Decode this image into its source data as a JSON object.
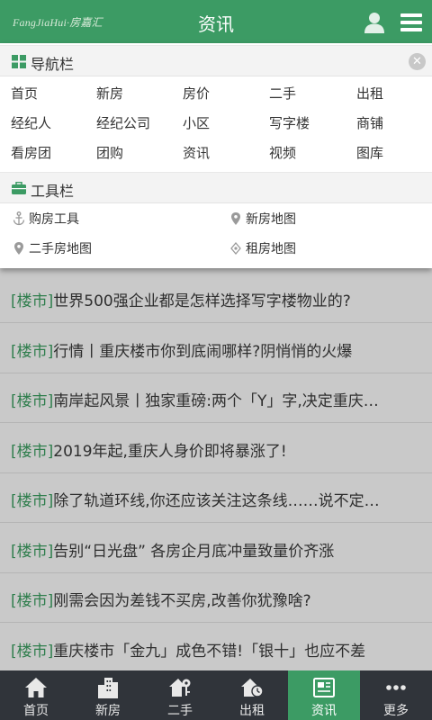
{
  "header": {
    "logo": "FangJiaHui·房嘉汇",
    "title": "资讯"
  },
  "nav_section": {
    "title": "导航栏",
    "items": [
      "首页",
      "新房",
      "房价",
      "二手",
      "出租",
      "经纪人",
      "经纪公司",
      "小区",
      "写字楼",
      "商铺",
      "看房团",
      "团购",
      "资讯",
      "视频",
      "图库"
    ]
  },
  "tool_section": {
    "title": "工具栏",
    "items": [
      "购房工具",
      "新房地图",
      "二手房地图",
      "租房地图"
    ]
  },
  "news": [
    {
      "tag": "[楼市]",
      "title": "世界500强企业都是怎样选择写字楼物业的?"
    },
    {
      "tag": "[楼市]",
      "title": "行情丨重庆楼市你到底闹哪样?阴悄悄的火爆"
    },
    {
      "tag": "[楼市]",
      "title": "南岸起风景丨独家重磅:两个「Y」字,决定重庆…"
    },
    {
      "tag": "[楼市]",
      "title": "2019年起,重庆人身价即将暴涨了!"
    },
    {
      "tag": "[楼市]",
      "title": "除了轨道环线,你还应该关注这条线……说不定…"
    },
    {
      "tag": "[楼市]",
      "title": "告别“日光盘” 各房企月底冲量致量价齐涨"
    },
    {
      "tag": "[楼市]",
      "title": "刚需会因为差钱不买房,改善你犹豫啥?"
    },
    {
      "tag": "[楼市]",
      "title": "重庆楼市「金九」成色不错!「银十」也应不差"
    }
  ],
  "bottom_nav": {
    "tabs": [
      "首页",
      "新房",
      "二手",
      "出租",
      "资讯",
      "更多"
    ],
    "active": "资讯"
  },
  "colors": {
    "brand_green": "#3c9b64",
    "tag_green": "#2f7e4d",
    "bottom_bar": "#30343a"
  }
}
